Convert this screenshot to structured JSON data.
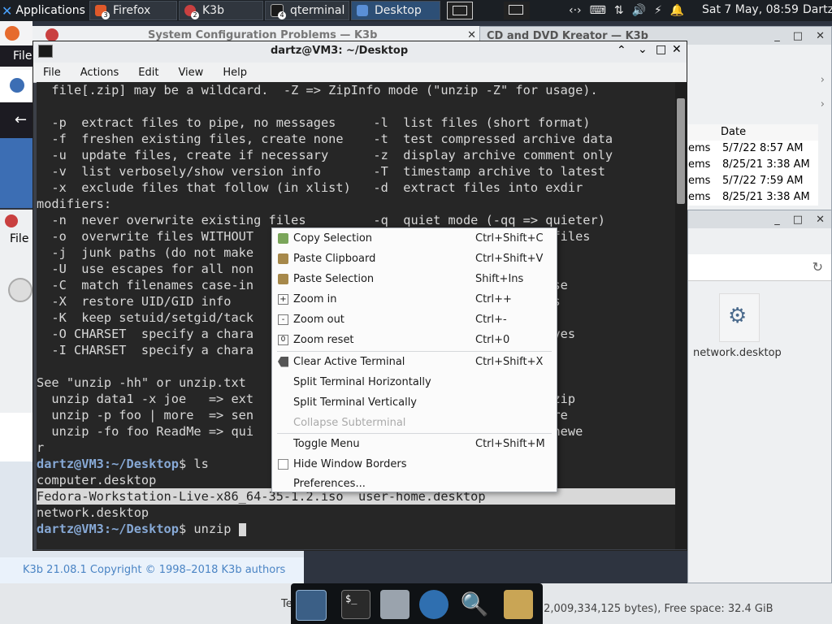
{
  "panel": {
    "apps_label": "Applications",
    "tasks": [
      {
        "label": "Firefox",
        "badge": "3"
      },
      {
        "label": "K3b",
        "badge": "2"
      },
      {
        "label": "qterminal",
        "badge": "4"
      },
      {
        "label": "Desktop",
        "badge": ""
      }
    ],
    "clock": "Sat  7 May, 08:59",
    "user": "Dartz"
  },
  "bg_windows": {
    "k3b_title": "System Configuration Problems — K3b",
    "cd_title": "CD and DVD Kreator — K3b",
    "file_menu": "File",
    "date_header": "Date",
    "rows": [
      {
        "name": "ems",
        "date": "5/7/22 8:57 AM"
      },
      {
        "name": "ems",
        "date": "8/25/21 3:38 AM"
      },
      {
        "name": "ems",
        "date": "5/7/22 7:59 AM"
      },
      {
        "name": "ems",
        "date": "8/25/21 3:38 AM"
      }
    ],
    "desktop_file": "network.desktop",
    "copyright": "K3b 21.08.1 Copyright © 1998–2018 K3b authors",
    "free_space": "(2,009,334,125 bytes), Free space: 32.4 GiB",
    "te_text": "Te"
  },
  "terminal": {
    "title": "dartz@VM3: ~/Desktop",
    "menu": [
      "File",
      "Actions",
      "Edit",
      "View",
      "Help"
    ],
    "lines": [
      "  file[.zip] may be a wildcard.  -Z => ZipInfo mode (\"unzip -Z\" for usage).",
      "",
      "  -p  extract files to pipe, no messages     -l  list files (short format)",
      "  -f  freshen existing files, create none    -t  test compressed archive data",
      "  -u  update files, create if necessary      -z  display archive comment only",
      "  -v  list verbosely/show version info       -T  timestamp archive to latest",
      "  -x  exclude files that follow (in xlist)   -d  extract files into exdir",
      "modifiers:",
      "  -n  never overwrite existing files         -q  quiet mode (-qq => quieter)",
      "  -o  overwrite files WITHOUT                                 y text files",
      "  -j  junk paths (do not make                              as text",
      "  -U  use escapes for all non                              ode fields",
      "  -C  match filenames case-in                              es lowercase",
      "  -X  restore UID/GID info                                 ion numbers",
      "  -K  keep setuid/setgid/tack                              ore\" pager",
      "  -O CHARSET  specify a chara                              OS/2 archives",
      "  -I CHARSET  specify a chara                              chives",
      "",
      "See \"unzip -hh\" or unzip.txt",
      "  unzip data1 -x joe   => ext                              ile data1.zip",
      "  unzip -p foo | more  => sen                              program more",
      "  unzip -fo foo ReadMe => qui                              hive file newe",
      "r"
    ],
    "prompt": "dartz@VM3:~/Desktop",
    "cmd1": " ls",
    "ls_line1": "computer.desktop",
    "ls_line2": "Fedora-Workstation-Live-x86_64-35-1.2.iso  user-home.desktop",
    "ls_line3": "network.desktop",
    "cmd2": " unzip "
  },
  "context_menu": {
    "items": [
      {
        "label": "Copy Selection",
        "shortcut": "Ctrl+Shift+C",
        "icon": "copy-icon"
      },
      {
        "label": "Paste Clipboard",
        "shortcut": "Ctrl+Shift+V",
        "icon": "paste-icon"
      },
      {
        "label": "Paste Selection",
        "shortcut": "Shift+Ins",
        "icon": "paste-icon"
      },
      {
        "label": "Zoom in",
        "shortcut": "Ctrl++",
        "icon": "zoom-in-icon"
      },
      {
        "label": "Zoom out",
        "shortcut": "Ctrl+-",
        "icon": "zoom-out-icon"
      },
      {
        "label": "Zoom reset",
        "shortcut": "Ctrl+0",
        "icon": "zoom-reset-icon"
      },
      {
        "label": "Clear Active Terminal",
        "shortcut": "Ctrl+Shift+X",
        "icon": "clear-icon"
      },
      {
        "label": "Split Terminal Horizontally",
        "shortcut": "",
        "icon": ""
      },
      {
        "label": "Split Terminal Vertically",
        "shortcut": "",
        "icon": ""
      },
      {
        "label": "Collapse Subterminal",
        "shortcut": "",
        "icon": "",
        "disabled": true
      },
      {
        "label": "Toggle Menu",
        "shortcut": "Ctrl+Shift+M",
        "icon": ""
      },
      {
        "label": "Hide Window Borders",
        "shortcut": "",
        "icon": "checkbox-icon"
      },
      {
        "label": "Preferences...",
        "shortcut": "",
        "icon": ""
      }
    ]
  },
  "colors": {
    "panel_bg": "#1b1f24",
    "terminal_bg": "#262626",
    "prompt": "#87a9d6",
    "accent": "#2d4f76"
  }
}
